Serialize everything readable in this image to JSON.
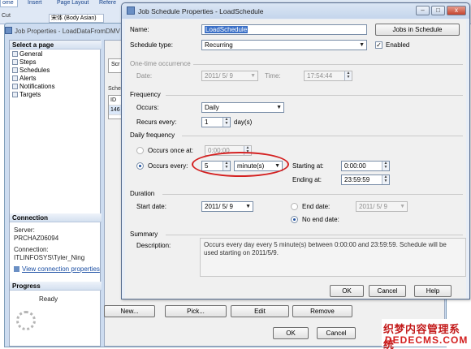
{
  "ribbon": {
    "tabs": [
      "ome",
      "Insert",
      "Page Layout",
      "Refere"
    ],
    "cut": "Cut",
    "font": "宋体 (Body Asian)"
  },
  "job_window": {
    "title": "Job Properties - LoadDataFromDMV",
    "select_page_header": "Select a page",
    "pages": [
      "General",
      "Steps",
      "Schedules",
      "Alerts",
      "Notifications",
      "Targets"
    ],
    "connection_header": "Connection",
    "server_label": "Server:",
    "server_value": "PRCHAZ06094",
    "connection_label": "Connection:",
    "connection_value": "ITLINFOSYS\\Tyler_Ning",
    "view_connection_link": "View connection properties",
    "progress_header": "Progress",
    "progress_status": "Ready",
    "tab_fragment": "Scr",
    "schedule_list_label": "Sched",
    "grid_header": "ID",
    "grid_row": "146",
    "buttons": {
      "new": "New...",
      "pick": "Pick...",
      "edit": "Edit",
      "remove": "Remove",
      "ok": "OK",
      "cancel": "Cancel"
    }
  },
  "dialog": {
    "title": "Job Schedule Properties - LoadSchedule",
    "window_buttons": {
      "minimize": "–",
      "maximize": "□",
      "close": "x"
    },
    "name_label": "Name:",
    "name_value": "LoadSchedule",
    "jobs_in_schedule": "Jobs in Schedule",
    "schedule_type_label": "Schedule type:",
    "schedule_type_value": "Recurring",
    "enabled_label": "Enabled",
    "one_time": {
      "header": "One-time occurrence",
      "date_label": "Date:",
      "date_value": "2011/ 5/ 9",
      "time_label": "Time:",
      "time_value": "17:54:44"
    },
    "frequency": {
      "header": "Frequency",
      "occurs_label": "Occurs:",
      "occurs_value": "Daily",
      "recurs_label": "Recurs every:",
      "recurs_value": "1",
      "recurs_unit": "day(s)"
    },
    "daily": {
      "header": "Daily frequency",
      "once_label": "Occurs once at:",
      "once_value": "0:00:00",
      "every_label": "Occurs every:",
      "every_value": "5",
      "every_unit": "minute(s)",
      "starting_label": "Starting at:",
      "starting_value": "0:00:00",
      "ending_label": "Ending at:",
      "ending_value": "23:59:59"
    },
    "duration": {
      "header": "Duration",
      "start_label": "Start date:",
      "start_value": "2011/ 5/ 9",
      "end_label": "End date:",
      "end_value": "2011/ 5/ 9",
      "no_end_label": "No end date:"
    },
    "summary": {
      "header": "Summary",
      "description_label": "Description:",
      "description": "Occurs every day every 5 minute(s) between 0:00:00 and 23:59:59. Schedule will be used starting on 2011/5/9."
    },
    "buttons": {
      "ok": "OK",
      "cancel": "Cancel",
      "help": "Help"
    }
  },
  "watermark": {
    "line1": "织梦内容管理系统",
    "line2": "DEDECMS.COM"
  },
  "colors": {
    "annotation_circle": "#d42020",
    "dialog_background": "#f0f0f0",
    "title_bar": "#c4d5ec",
    "selection": "#3a6fc6",
    "watermark": "#c31b1b"
  }
}
